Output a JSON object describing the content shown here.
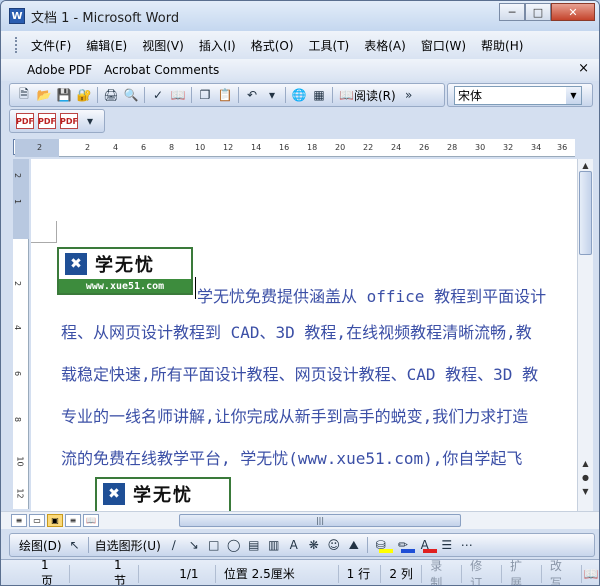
{
  "window": {
    "title": "文档 1 - Microsoft Word",
    "app_icon_glyph": "W"
  },
  "menubar": {
    "items": [
      "文件(F)",
      "编辑(E)",
      "视图(V)",
      "插入(I)",
      "格式(O)",
      "工具(T)",
      "表格(A)",
      "窗口(W)",
      "帮助(H)"
    ]
  },
  "pdfbar": {
    "items": [
      "Adobe PDF",
      "Acrobat Comments"
    ],
    "close_glyph": "×"
  },
  "standard_toolbar": {
    "reading_label": "阅读(R)",
    "font_name": "宋体"
  },
  "ruler": {
    "corner_label": "L",
    "h_ticks": [
      "2",
      "2",
      "4",
      "6",
      "8",
      "10",
      "12",
      "14",
      "16",
      "18",
      "20",
      "22",
      "24",
      "26",
      "28",
      "30",
      "32",
      "34",
      "36"
    ],
    "v_ticks": [
      "2",
      "1",
      "2",
      "4",
      "6",
      "8",
      "10",
      "12"
    ]
  },
  "document": {
    "logo_name": "学无忧",
    "logo_url": "www.xue51.com",
    "lines": [
      "学无忧免费提供涵盖从 office 教程到平面设计",
      "程、从网页设计教程到 CAD、3D 教程,在线视频教程清晰流畅,教",
      "载稳定快速,所有平面设计教程、网页设计教程、CAD 教程、3D 教",
      "专业的一线名师讲解,让你完成从新手到高手的蜕变,我们力求打造",
      "流的免费在线教学平台, 学无忧(www.xue51.com),你自学起飞"
    ]
  },
  "drawing_toolbar": {
    "draw_label": "绘图(D)",
    "autoshape_label": "自选图形(U)"
  },
  "statusbar": {
    "page": "1 页",
    "section": "1 节",
    "page_of": "1/1",
    "position": "位置 2.5厘米",
    "line": "1 行",
    "column": "2 列",
    "rec": "录制",
    "trk": "修订",
    "ext": "扩展",
    "ovr": "改写"
  },
  "colors": {
    "doc_text": "#3b4fa6",
    "logo_green": "#3d8c3d",
    "logo_blue": "#1f4f96"
  }
}
